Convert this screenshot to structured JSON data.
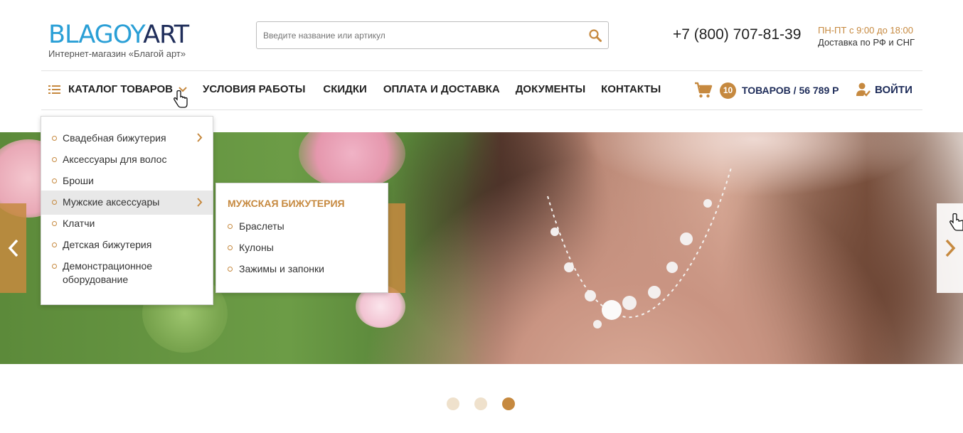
{
  "header": {
    "logo_part1": "BLAGOY",
    "logo_part2": "ART",
    "logo_subtitle": "Интернет-магазин «Благой арт»",
    "search_placeholder": "Введите название или артикул",
    "phone": "+7 (800) 707-81-39",
    "hours": "ПН-ПТ с 9:00 до 18:00",
    "delivery": "Доставка по РФ и СНГ"
  },
  "nav": {
    "catalog_label": "КАТАЛОГ ТОВАРОВ",
    "items": [
      "УСЛОВИЯ РАБОТЫ",
      "СКИДКИ",
      "ОПЛАТА И ДОСТАВКА",
      "ДОКУМЕНТЫ",
      "КОНТАКТЫ"
    ],
    "cart_count": "10",
    "cart_summary": "ТОВАРОВ / 56 789 Р",
    "login_label": "ВОЙТИ"
  },
  "catalog_menu": {
    "items": [
      "Свадебная бижутерия",
      "Аксессуары для волос",
      "Броши",
      "Мужские аксессуары",
      "Клатчи",
      "Детская бижутерия",
      "Демонстрационное оборудование"
    ],
    "active_index": 3,
    "submenu": {
      "title": "МУЖСКАЯ БИЖУТЕРИЯ",
      "items": [
        "Браслеты",
        "Кулоны",
        "Зажимы и запонки"
      ]
    }
  },
  "slider": {
    "total_slides": 3,
    "active_slide": 3
  },
  "colors": {
    "accent": "#c6893f",
    "navy": "#1f2d5a",
    "logo_blue": "#2a9fd6"
  }
}
